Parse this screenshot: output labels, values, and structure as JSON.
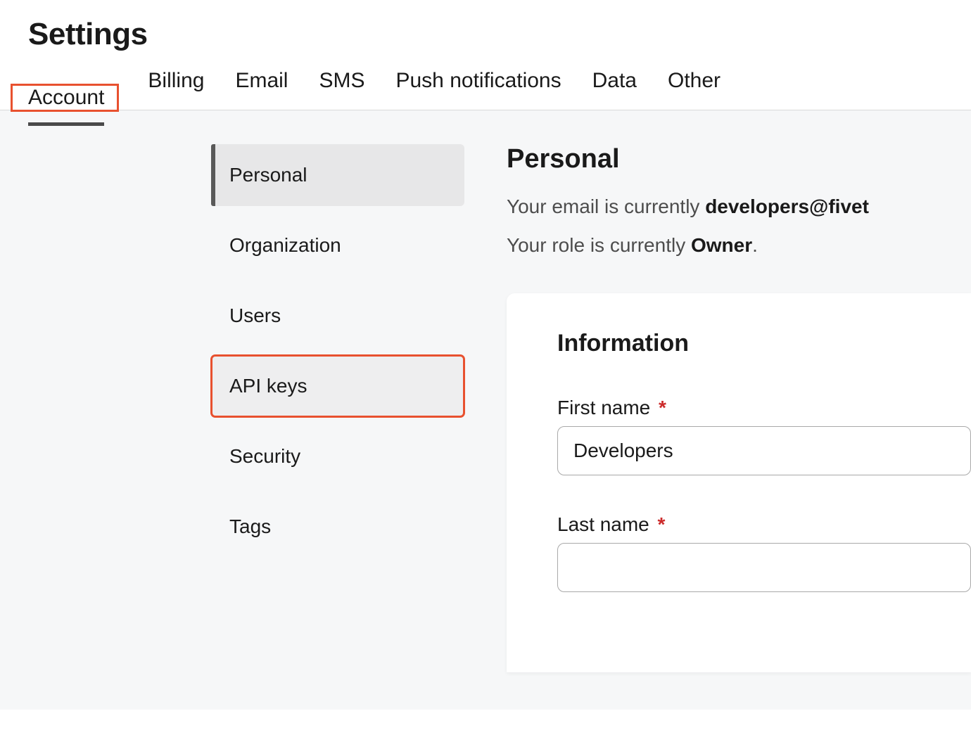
{
  "page_title": "Settings",
  "tabs": [
    {
      "label": "Account",
      "active": true,
      "highlighted": true
    },
    {
      "label": "Billing",
      "active": false,
      "highlighted": false
    },
    {
      "label": "Email",
      "active": false,
      "highlighted": false
    },
    {
      "label": "SMS",
      "active": false,
      "highlighted": false
    },
    {
      "label": "Push notifications",
      "active": false,
      "highlighted": false
    },
    {
      "label": "Data",
      "active": false,
      "highlighted": false
    },
    {
      "label": "Other",
      "active": false,
      "highlighted": false
    }
  ],
  "sidebar": {
    "items": [
      {
        "label": "Personal",
        "active": true,
        "highlighted": false
      },
      {
        "label": "Organization",
        "active": false,
        "highlighted": false
      },
      {
        "label": "Users",
        "active": false,
        "highlighted": false
      },
      {
        "label": "API keys",
        "active": false,
        "highlighted": true
      },
      {
        "label": "Security",
        "active": false,
        "highlighted": false
      },
      {
        "label": "Tags",
        "active": false,
        "highlighted": false
      }
    ]
  },
  "main": {
    "heading": "Personal",
    "email_line_prefix": "Your email is currently ",
    "email_value": "developers@fivet",
    "role_line_prefix": "Your role is currently ",
    "role_value": "Owner",
    "role_line_suffix": ".",
    "card": {
      "title": "Information",
      "fields": {
        "first_name": {
          "label": "First name",
          "required": true,
          "value": "Developers"
        },
        "last_name": {
          "label": "Last name",
          "required": true,
          "value": ""
        }
      }
    }
  },
  "colors": {
    "highlight_outline": "#e8512f",
    "body_bg": "#f6f7f8",
    "required_asterisk": "#cc2b2b"
  }
}
